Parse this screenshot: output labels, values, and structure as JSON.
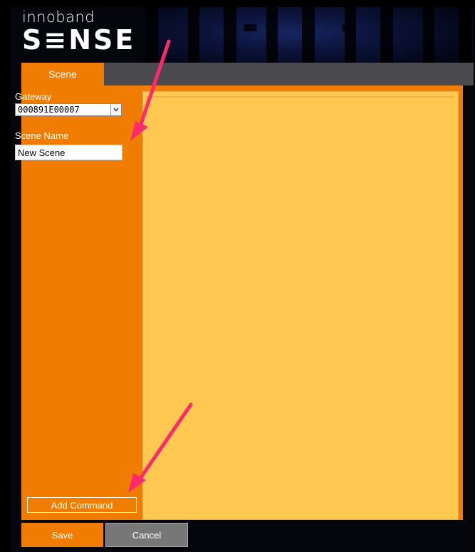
{
  "logo": {
    "top": "innoband",
    "main": "S≡NSE"
  },
  "tabs": [
    {
      "label": "Scene",
      "active": true
    }
  ],
  "form": {
    "gateway_label": "Gateway",
    "gateway_value": "000891E00007",
    "scene_name_label": "Scene Name",
    "scene_name_value": "New Scene"
  },
  "buttons": {
    "add_command": "Add Command",
    "save": "Save",
    "cancel": "Cancel"
  },
  "colors": {
    "accent": "#f07d00",
    "canvas": "#ffc850",
    "annotation_arrow": "#ff2a6d"
  }
}
